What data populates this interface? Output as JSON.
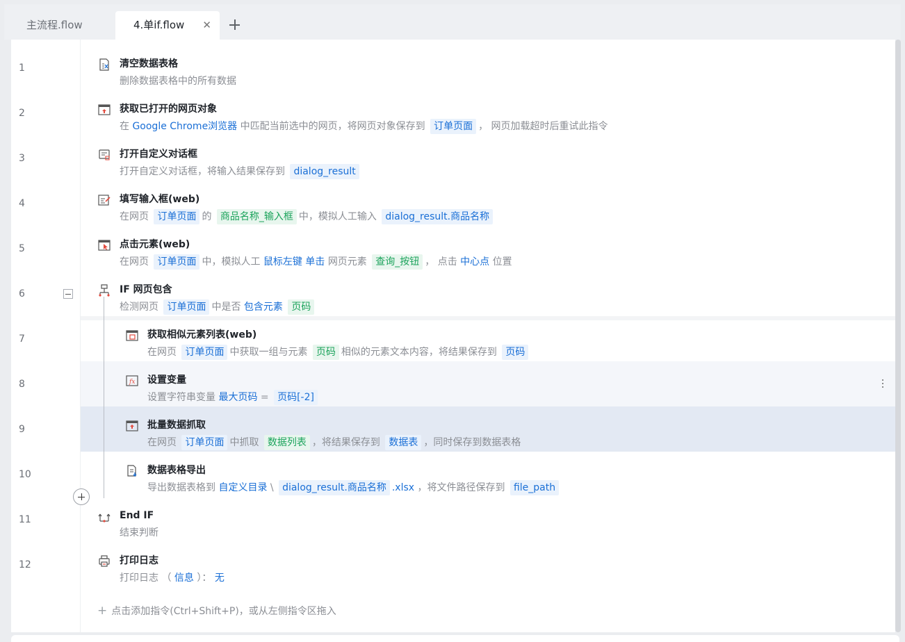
{
  "tabs": {
    "main_label": "主流程.flow",
    "active_label": "4.单if.flow",
    "close_glyph": "✕"
  },
  "lines": [
    "1",
    "2",
    "3",
    "4",
    "5",
    "6",
    "7",
    "8",
    "9",
    "10",
    "11",
    "12"
  ],
  "commands": [
    {
      "title": "清空数据表格",
      "icon": "clear-table-icon",
      "desc": [
        {
          "t": "删除数据表格中的所有数据",
          "s": "plain"
        }
      ]
    },
    {
      "title": "获取已打开的网页对象",
      "icon": "browser-window-icon",
      "desc": [
        {
          "t": "在",
          "s": "plain"
        },
        {
          "t": "Google Chrome浏览器",
          "s": "blue"
        },
        {
          "t": "中匹配当前选中的网页，将网页对象保存到",
          "s": "plain"
        },
        {
          "t": "订单页面",
          "s": "chip"
        },
        {
          "t": "，",
          "s": "plain"
        },
        {
          "t": "网页加载超时后重试此指令",
          "s": "plain"
        }
      ]
    },
    {
      "title": "打开自定义对话框",
      "icon": "dialog-icon",
      "desc": [
        {
          "t": "打开自定义对话框，将输入结果保存到",
          "s": "plain"
        },
        {
          "t": "dialog_result",
          "s": "chip"
        }
      ]
    },
    {
      "title": "填写输入框(web)",
      "icon": "edit-input-icon",
      "desc": [
        {
          "t": "在网页",
          "s": "plain"
        },
        {
          "t": "订单页面",
          "s": "chip"
        },
        {
          "t": "的",
          "s": "plain"
        },
        {
          "t": "商品名称_输入框",
          "s": "green"
        },
        {
          "t": "中，模拟人工输入",
          "s": "plain"
        },
        {
          "t": "dialog_result.商品名称",
          "s": "chip"
        }
      ]
    },
    {
      "title": "点击元素(web)",
      "icon": "click-element-icon",
      "desc": [
        {
          "t": "在网页",
          "s": "plain"
        },
        {
          "t": "订单页面",
          "s": "chip"
        },
        {
          "t": "中，模拟人工",
          "s": "plain"
        },
        {
          "t": "鼠标左键",
          "s": "blue"
        },
        {
          "t": "单击",
          "s": "blue"
        },
        {
          "t": "网页元素",
          "s": "plain"
        },
        {
          "t": "查询_按钮",
          "s": "green"
        },
        {
          "t": "，",
          "s": "plain"
        },
        {
          "t": "点击",
          "s": "plain"
        },
        {
          "t": "中心点",
          "s": "blue"
        },
        {
          "t": "位置",
          "s": "plain"
        }
      ]
    },
    {
      "title": "IF 网页包含",
      "icon": "if-branch-icon",
      "desc": [
        {
          "t": "检测网页",
          "s": "plain"
        },
        {
          "t": "订单页面",
          "s": "chip"
        },
        {
          "t": "中是否",
          "s": "plain"
        },
        {
          "t": "包含元素",
          "s": "blue"
        },
        {
          "t": "页码",
          "s": "green"
        }
      ]
    },
    {
      "title": "获取相似元素列表(web)",
      "icon": "similar-elements-icon",
      "desc": [
        {
          "t": "在网页",
          "s": "plain"
        },
        {
          "t": "订单页面",
          "s": "chip"
        },
        {
          "t": "中获取一组与元素",
          "s": "plain"
        },
        {
          "t": "页码",
          "s": "green"
        },
        {
          "t": "相似的元素文本内容，将结果保存到",
          "s": "plain"
        },
        {
          "t": "页码",
          "s": "chip"
        }
      ]
    },
    {
      "title": "设置变量",
      "icon": "set-variable-icon",
      "desc": [
        {
          "t": "设置字符串变量",
          "s": "plain"
        },
        {
          "t": "最大页码",
          "s": "blue"
        },
        {
          "t": "=",
          "s": "plain"
        },
        {
          "t": "页码[-2]",
          "s": "chip"
        }
      ]
    },
    {
      "title": "批量数据抓取",
      "icon": "batch-scrape-icon",
      "desc": [
        {
          "t": "在网页",
          "s": "plain"
        },
        {
          "t": "订单页面",
          "s": "chip"
        },
        {
          "t": "中抓取",
          "s": "plain"
        },
        {
          "t": "数据列表",
          "s": "green"
        },
        {
          "t": "，将结果保存到",
          "s": "plain"
        },
        {
          "t": "数据表",
          "s": "chip"
        },
        {
          "t": "，同时保存到数据表格",
          "s": "plain"
        }
      ]
    },
    {
      "title": "数据表格导出",
      "icon": "export-file-icon",
      "desc": [
        {
          "t": "导出数据表格到",
          "s": "plain"
        },
        {
          "t": "自定义目录",
          "s": "blue"
        },
        {
          "t": "\\",
          "s": "plain"
        },
        {
          "t": "dialog_result.商品名称",
          "s": "chip"
        },
        {
          "t": ".xlsx",
          "s": "blue"
        },
        {
          "t": "，将文件路径保存到",
          "s": "plain"
        },
        {
          "t": "file_path",
          "s": "chip"
        }
      ]
    },
    {
      "title": "End IF",
      "icon": "end-if-icon",
      "desc": [
        {
          "t": "结束判断",
          "s": "plain"
        }
      ]
    },
    {
      "title": "打印日志",
      "icon": "print-log-icon",
      "desc": [
        {
          "t": "打印日志",
          "s": "plain"
        },
        {
          "t": "（",
          "s": "plain"
        },
        {
          "t": "信息",
          "s": "blue"
        },
        {
          "t": "）：",
          "s": "plain"
        },
        {
          "t": "无",
          "s": "blue"
        }
      ]
    }
  ],
  "add_hint": "点击添加指令(Ctrl+Shift+P)，或从左侧指令区拖入"
}
